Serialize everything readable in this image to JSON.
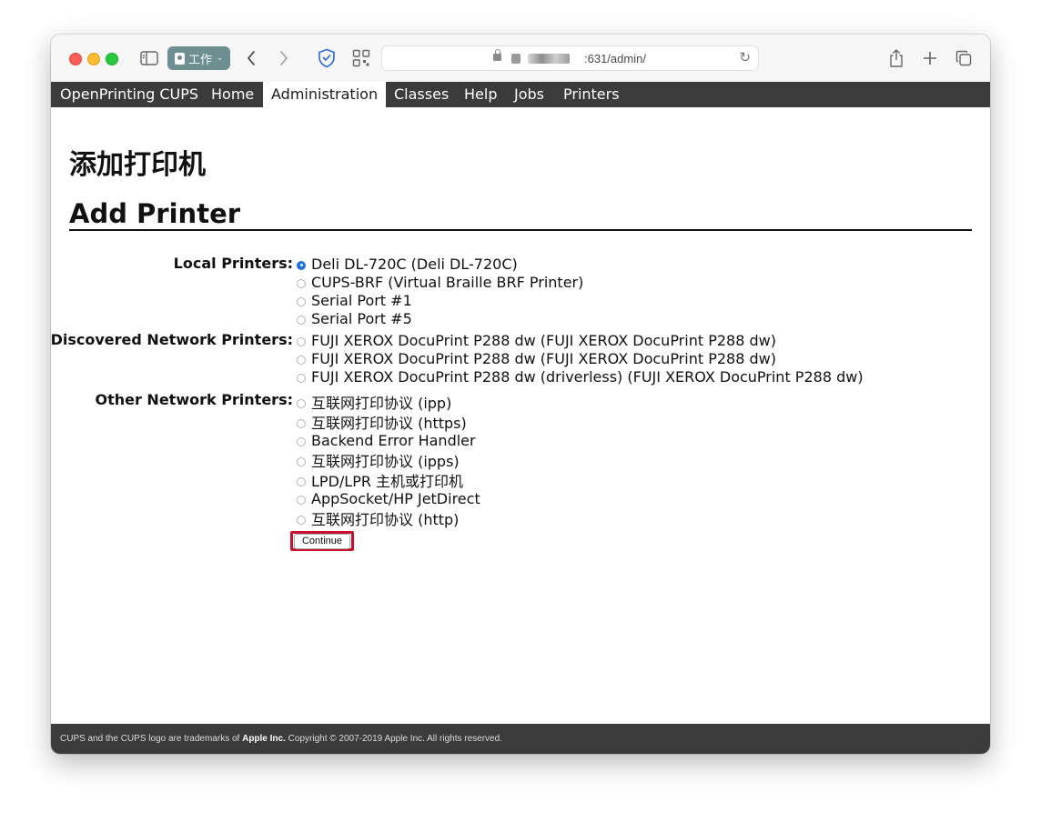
{
  "browser": {
    "profile_label": "工作",
    "url_text": ":631/admin/",
    "icons": [
      "sidebar-icon",
      "back-icon",
      "forward-icon",
      "shield-icon",
      "qr-icon",
      "lock-icon",
      "reload-icon",
      "share-icon",
      "new-tab-icon",
      "tab-overview-icon"
    ]
  },
  "nav": {
    "brand": "OpenPrinting CUPS",
    "items": [
      {
        "label": "Home"
      },
      {
        "label": "Administration"
      },
      {
        "label": "Classes"
      },
      {
        "label": "Help"
      },
      {
        "label": "Jobs"
      },
      {
        "label": "Printers"
      }
    ],
    "active": "Administration"
  },
  "page": {
    "title_zh": "添加打印机",
    "title_en": "Add Printer"
  },
  "groups": {
    "local": {
      "label": "Local Printers:",
      "options": [
        {
          "label": "Deli DL-720C (Deli DL-720C)",
          "checked": true
        },
        {
          "label": "CUPS-BRF (Virtual Braille BRF Printer)",
          "checked": false
        },
        {
          "label": "Serial Port #1",
          "checked": false
        },
        {
          "label": "Serial Port #5",
          "checked": false
        }
      ]
    },
    "discovered": {
      "label": "Discovered Network Printers:",
      "options": [
        {
          "label": "FUJI XEROX DocuPrint P288 dw (FUJI XEROX DocuPrint P288 dw)",
          "checked": false
        },
        {
          "label": "FUJI XEROX DocuPrint P288 dw (FUJI XEROX DocuPrint P288 dw)",
          "checked": false
        },
        {
          "label": "FUJI XEROX DocuPrint P288 dw (driverless) (FUJI XEROX DocuPrint P288 dw)",
          "checked": false
        }
      ]
    },
    "other": {
      "label": "Other Network Printers:",
      "options": [
        {
          "label": "互联网打印协议 (ipp)",
          "checked": false
        },
        {
          "label": "互联网打印协议 (https)",
          "checked": false
        },
        {
          "label": "Backend Error Handler",
          "checked": false
        },
        {
          "label": "互联网打印协议 (ipps)",
          "checked": false
        },
        {
          "label": "LPD/LPR 主机或打印机",
          "checked": false
        },
        {
          "label": "AppSocket/HP JetDirect",
          "checked": false
        },
        {
          "label": "互联网打印协议 (http)",
          "checked": false
        }
      ]
    }
  },
  "continue_label": "Continue",
  "footer": {
    "prefix": "CUPS and the CUPS logo are trademarks of ",
    "brand": "Apple Inc.",
    "suffix": " Copyright © 2007-2019 Apple Inc. All rights reserved."
  },
  "colors": {
    "navbar": "#3b3b3b",
    "radio_checked": "#1f6fe0",
    "highlight_border": "#c8102e"
  }
}
